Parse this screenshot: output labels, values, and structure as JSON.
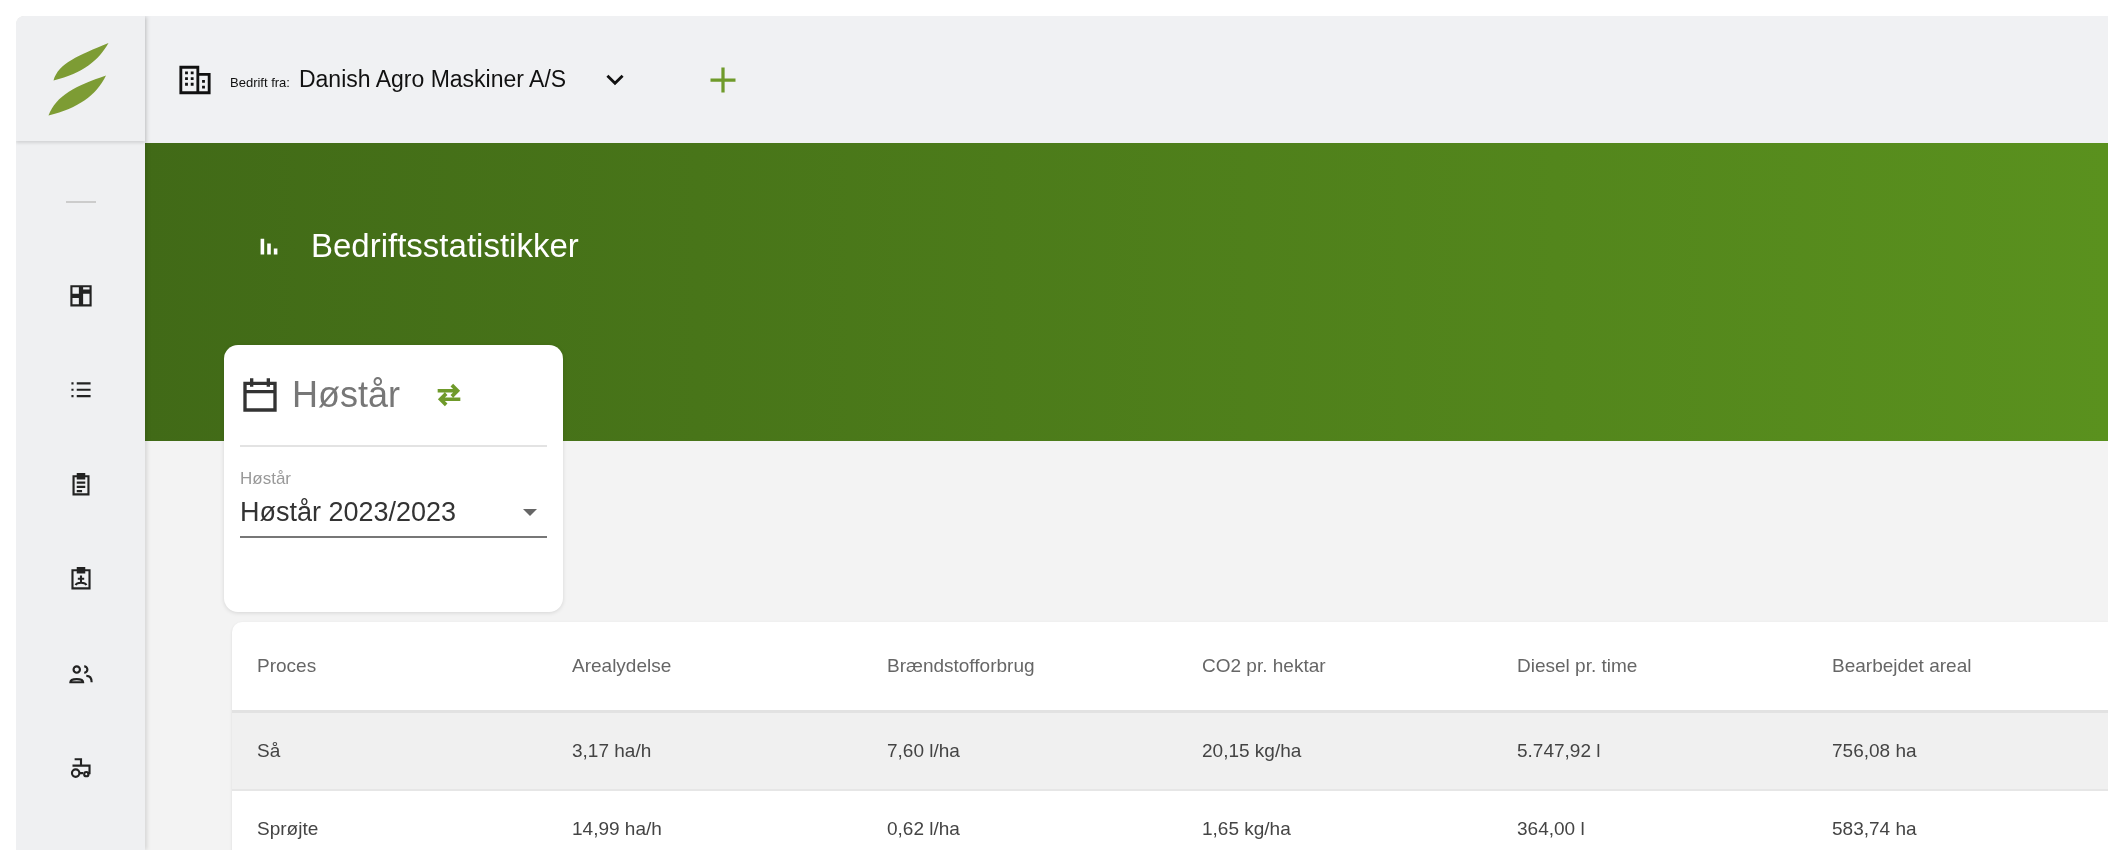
{
  "company_bar": {
    "label": "Bedrift fra:",
    "company": "Danish Agro Maskiner A/S"
  },
  "page": {
    "title": "Bedriftsstatistikker"
  },
  "harvest_card": {
    "title": "Høstår",
    "field_label": "Høstår",
    "value": "Høstår 2023/2023"
  },
  "table": {
    "columns": [
      "Proces",
      "Arealydelse",
      "Brændstofforbrug",
      "CO2 pr. hektar",
      "Diesel pr. time",
      "Bearbejdet areal"
    ],
    "rows": [
      {
        "selected": true,
        "cells": [
          "Så",
          "3,17 ha/h",
          "7,60 l/ha",
          "20,15 kg/ha",
          "5.747,92 l",
          "756,08 ha"
        ]
      },
      {
        "selected": false,
        "cells": [
          "Sprøjte",
          "14,99 ha/h",
          "0,62 l/ha",
          "1,65 kg/ha",
          "364,00 l",
          "583,74 ha"
        ]
      }
    ]
  }
}
